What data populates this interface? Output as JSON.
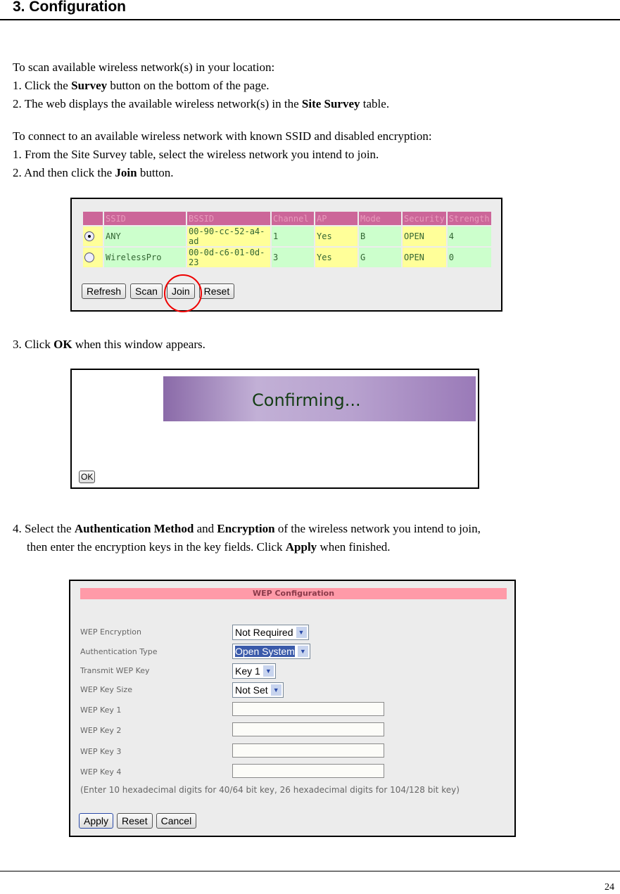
{
  "heading": "3. Configuration",
  "intro": {
    "line1": "To scan available wireless network(s) in your location:",
    "step1_pre": "1. Click the ",
    "step1_bold": "Survey",
    "step1_post": " button on the bottom of the page.",
    "step2_pre": "2. The web displays the available wireless network(s) in the ",
    "step2_bold": "Site Survey",
    "step2_post": " table."
  },
  "connect": {
    "line1": "To connect to an available wireless network with known SSID and disabled encryption:",
    "step1": "1. From the Site Survey table, select the wireless network you intend to join.",
    "step2_pre": "2. And then click the ",
    "step2_bold": "Join",
    "step2_post": " button."
  },
  "survey": {
    "headers": [
      "",
      "SSID",
      "BSSID",
      "Channel",
      "AP",
      "Mode",
      "Security",
      "Strength"
    ],
    "rows": [
      {
        "selected": true,
        "ssid": "ANY",
        "bssid": "00-90-cc-52-a4-ad",
        "channel": "1",
        "ap": "Yes",
        "mode": "B",
        "security": "OPEN",
        "strength": "4"
      },
      {
        "selected": false,
        "ssid": "WirelessPro",
        "bssid": "00-0d-c6-01-0d-23",
        "channel": "3",
        "ap": "Yes",
        "mode": "G",
        "security": "OPEN",
        "strength": "0"
      }
    ],
    "buttons": {
      "refresh": "Refresh",
      "scan": "Scan",
      "join": "Join",
      "reset": "Reset"
    }
  },
  "step3": {
    "pre": "3. Click ",
    "bold": "OK",
    "post": " when this window appears."
  },
  "confirm": {
    "banner_text": "Confirming...",
    "ok": "OK"
  },
  "step4": {
    "pre": "4. Select the ",
    "bold1": "Authentication Method",
    "mid": " and ",
    "bold2": "Encryption",
    "post1": " of the wireless network you intend to join,",
    "line2_pre": "then enter the encryption keys in the key fields. Click ",
    "line2_bold": "Apply",
    "line2_post": " when finished."
  },
  "wep": {
    "title": "WEP Configuration",
    "fields": [
      {
        "label": "WEP Encryption",
        "value": "Not Required"
      },
      {
        "label": "Authentication Type",
        "value": "Open System"
      },
      {
        "label": "Transmit WEP Key",
        "value": "Key 1"
      },
      {
        "label": "WEP Key Size",
        "value": "Not Set"
      }
    ],
    "keys": [
      {
        "label": "WEP Key 1",
        "value": ""
      },
      {
        "label": "WEP Key 2",
        "value": ""
      },
      {
        "label": "WEP Key 3",
        "value": ""
      },
      {
        "label": "WEP Key 4",
        "value": ""
      }
    ],
    "hint": "(Enter 10 hexadecimal digits for 40/64 bit key, 26 hexadecimal digits for 104/128 bit key)",
    "buttons": {
      "apply": "Apply",
      "reset": "Reset",
      "cancel": "Cancel"
    }
  },
  "page_number": "24"
}
